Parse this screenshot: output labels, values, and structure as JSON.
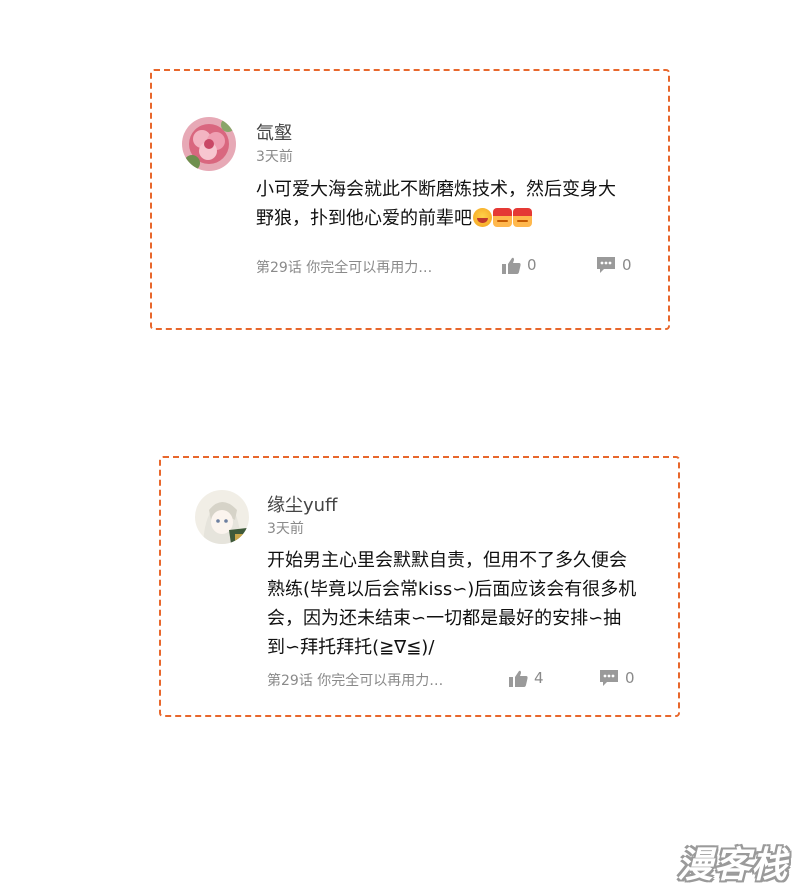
{
  "comments": [
    {
      "username": "氙壑",
      "time": "3天前",
      "lines": [
        "小可爱大海会就此不断磨炼技术，然后变身大",
        "野狼，扑到他心爱的前辈吧"
      ],
      "emojis": [
        "grin-emoji",
        "geili-emoji",
        "geili-emoji"
      ],
      "chapter_link": "第29话 你完全可以再用力…",
      "likes": "0",
      "replies": "0"
    },
    {
      "username": "缘尘yuff",
      "time": "3天前",
      "lines": [
        "开始男主心里会默默自责，但用不了多久便会",
        "熟练(毕竟以后会常kiss∽)后面应该会有很多机",
        "会，因为还未结束∽一切都是最好的安排∽抽",
        "到∽拜托拜托(≧∇≦)/"
      ],
      "chapter_link": "第29话 你完全可以再用力…",
      "likes": "4",
      "replies": "0"
    }
  ],
  "colors": {
    "card_border": "#e8672c",
    "meta_text": "#8a8a8a"
  },
  "watermark": "漫客栈"
}
